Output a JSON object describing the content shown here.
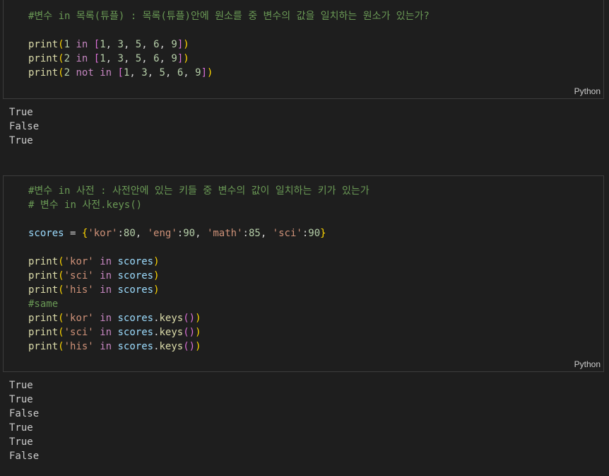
{
  "cells": [
    {
      "language": "Python",
      "lines": [
        [
          {
            "t": "#변수 in 목록(튜플) : 목록(튜플)안에 원소를 중 변수의 값을 일치하는 원소가 있는가?",
            "c": "comment"
          }
        ],
        [],
        [
          {
            "t": "print",
            "c": "fn"
          },
          {
            "t": "(",
            "c": "b1"
          },
          {
            "t": "1",
            "c": "num"
          },
          {
            "t": " ",
            "c": "plain"
          },
          {
            "t": "in",
            "c": "kw"
          },
          {
            "t": " ",
            "c": "plain"
          },
          {
            "t": "[",
            "c": "b2"
          },
          {
            "t": "1",
            "c": "num"
          },
          {
            "t": ", ",
            "c": "plain"
          },
          {
            "t": "3",
            "c": "num"
          },
          {
            "t": ", ",
            "c": "plain"
          },
          {
            "t": "5",
            "c": "num"
          },
          {
            "t": ", ",
            "c": "plain"
          },
          {
            "t": "6",
            "c": "num"
          },
          {
            "t": ", ",
            "c": "plain"
          },
          {
            "t": "9",
            "c": "num"
          },
          {
            "t": "]",
            "c": "b2"
          },
          {
            "t": ")",
            "c": "b1"
          }
        ],
        [
          {
            "t": "print",
            "c": "fn"
          },
          {
            "t": "(",
            "c": "b1"
          },
          {
            "t": "2",
            "c": "num"
          },
          {
            "t": " ",
            "c": "plain"
          },
          {
            "t": "in",
            "c": "kw"
          },
          {
            "t": " ",
            "c": "plain"
          },
          {
            "t": "[",
            "c": "b2"
          },
          {
            "t": "1",
            "c": "num"
          },
          {
            "t": ", ",
            "c": "plain"
          },
          {
            "t": "3",
            "c": "num"
          },
          {
            "t": ", ",
            "c": "plain"
          },
          {
            "t": "5",
            "c": "num"
          },
          {
            "t": ", ",
            "c": "plain"
          },
          {
            "t": "6",
            "c": "num"
          },
          {
            "t": ", ",
            "c": "plain"
          },
          {
            "t": "9",
            "c": "num"
          },
          {
            "t": "]",
            "c": "b2"
          },
          {
            "t": ")",
            "c": "b1"
          }
        ],
        [
          {
            "t": "print",
            "c": "fn"
          },
          {
            "t": "(",
            "c": "b1"
          },
          {
            "t": "2",
            "c": "num"
          },
          {
            "t": " ",
            "c": "plain"
          },
          {
            "t": "not",
            "c": "kw"
          },
          {
            "t": " ",
            "c": "plain"
          },
          {
            "t": "in",
            "c": "kw"
          },
          {
            "t": " ",
            "c": "plain"
          },
          {
            "t": "[",
            "c": "b2"
          },
          {
            "t": "1",
            "c": "num"
          },
          {
            "t": ", ",
            "c": "plain"
          },
          {
            "t": "3",
            "c": "num"
          },
          {
            "t": ", ",
            "c": "plain"
          },
          {
            "t": "5",
            "c": "num"
          },
          {
            "t": ", ",
            "c": "plain"
          },
          {
            "t": "6",
            "c": "num"
          },
          {
            "t": ", ",
            "c": "plain"
          },
          {
            "t": "9",
            "c": "num"
          },
          {
            "t": "]",
            "c": "b2"
          },
          {
            "t": ")",
            "c": "b1"
          }
        ]
      ],
      "output": [
        "True",
        "False",
        "True"
      ]
    },
    {
      "language": "Python",
      "lines": [
        [
          {
            "t": "#변수 in 사전 : 사전안에 있는 키들 중 변수의 값이 일치하는 키가 있는가",
            "c": "comment"
          }
        ],
        [
          {
            "t": "# 변수 in 사전.keys()",
            "c": "comment"
          }
        ],
        [],
        [
          {
            "t": "scores",
            "c": "var"
          },
          {
            "t": " = ",
            "c": "op"
          },
          {
            "t": "{",
            "c": "b1"
          },
          {
            "t": "'kor'",
            "c": "str"
          },
          {
            "t": ":",
            "c": "plain"
          },
          {
            "t": "80",
            "c": "num"
          },
          {
            "t": ", ",
            "c": "plain"
          },
          {
            "t": "'eng'",
            "c": "str"
          },
          {
            "t": ":",
            "c": "plain"
          },
          {
            "t": "90",
            "c": "num"
          },
          {
            "t": ", ",
            "c": "plain"
          },
          {
            "t": "'math'",
            "c": "str"
          },
          {
            "t": ":",
            "c": "plain"
          },
          {
            "t": "85",
            "c": "num"
          },
          {
            "t": ", ",
            "c": "plain"
          },
          {
            "t": "'sci'",
            "c": "str"
          },
          {
            "t": ":",
            "c": "plain"
          },
          {
            "t": "90",
            "c": "num"
          },
          {
            "t": "}",
            "c": "b1"
          }
        ],
        [],
        [
          {
            "t": "print",
            "c": "fn"
          },
          {
            "t": "(",
            "c": "b1"
          },
          {
            "t": "'kor'",
            "c": "str"
          },
          {
            "t": " ",
            "c": "plain"
          },
          {
            "t": "in",
            "c": "kw"
          },
          {
            "t": " ",
            "c": "plain"
          },
          {
            "t": "scores",
            "c": "var"
          },
          {
            "t": ")",
            "c": "b1"
          }
        ],
        [
          {
            "t": "print",
            "c": "fn"
          },
          {
            "t": "(",
            "c": "b1"
          },
          {
            "t": "'sci'",
            "c": "str"
          },
          {
            "t": " ",
            "c": "plain"
          },
          {
            "t": "in",
            "c": "kw"
          },
          {
            "t": " ",
            "c": "plain"
          },
          {
            "t": "scores",
            "c": "var"
          },
          {
            "t": ")",
            "c": "b1"
          }
        ],
        [
          {
            "t": "print",
            "c": "fn"
          },
          {
            "t": "(",
            "c": "b1"
          },
          {
            "t": "'his'",
            "c": "str"
          },
          {
            "t": " ",
            "c": "plain"
          },
          {
            "t": "in",
            "c": "kw"
          },
          {
            "t": " ",
            "c": "plain"
          },
          {
            "t": "scores",
            "c": "var"
          },
          {
            "t": ")",
            "c": "b1"
          }
        ],
        [
          {
            "t": "#same",
            "c": "comment"
          }
        ],
        [
          {
            "t": "print",
            "c": "fn"
          },
          {
            "t": "(",
            "c": "b1"
          },
          {
            "t": "'kor'",
            "c": "str"
          },
          {
            "t": " ",
            "c": "plain"
          },
          {
            "t": "in",
            "c": "kw"
          },
          {
            "t": " ",
            "c": "plain"
          },
          {
            "t": "scores",
            "c": "var"
          },
          {
            "t": ".",
            "c": "plain"
          },
          {
            "t": "keys",
            "c": "fn"
          },
          {
            "t": "()",
            "c": "b2"
          },
          {
            "t": ")",
            "c": "b1"
          }
        ],
        [
          {
            "t": "print",
            "c": "fn"
          },
          {
            "t": "(",
            "c": "b1"
          },
          {
            "t": "'sci'",
            "c": "str"
          },
          {
            "t": " ",
            "c": "plain"
          },
          {
            "t": "in",
            "c": "kw"
          },
          {
            "t": " ",
            "c": "plain"
          },
          {
            "t": "scores",
            "c": "var"
          },
          {
            "t": ".",
            "c": "plain"
          },
          {
            "t": "keys",
            "c": "fn"
          },
          {
            "t": "()",
            "c": "b2"
          },
          {
            "t": ")",
            "c": "b1"
          }
        ],
        [
          {
            "t": "print",
            "c": "fn"
          },
          {
            "t": "(",
            "c": "b1"
          },
          {
            "t": "'his'",
            "c": "str"
          },
          {
            "t": " ",
            "c": "plain"
          },
          {
            "t": "in",
            "c": "kw"
          },
          {
            "t": " ",
            "c": "plain"
          },
          {
            "t": "scores",
            "c": "var"
          },
          {
            "t": ".",
            "c": "plain"
          },
          {
            "t": "keys",
            "c": "fn"
          },
          {
            "t": "()",
            "c": "b2"
          },
          {
            "t": ")",
            "c": "b1"
          }
        ]
      ],
      "output": [
        "True",
        "True",
        "False",
        "True",
        "True",
        "False"
      ]
    }
  ]
}
